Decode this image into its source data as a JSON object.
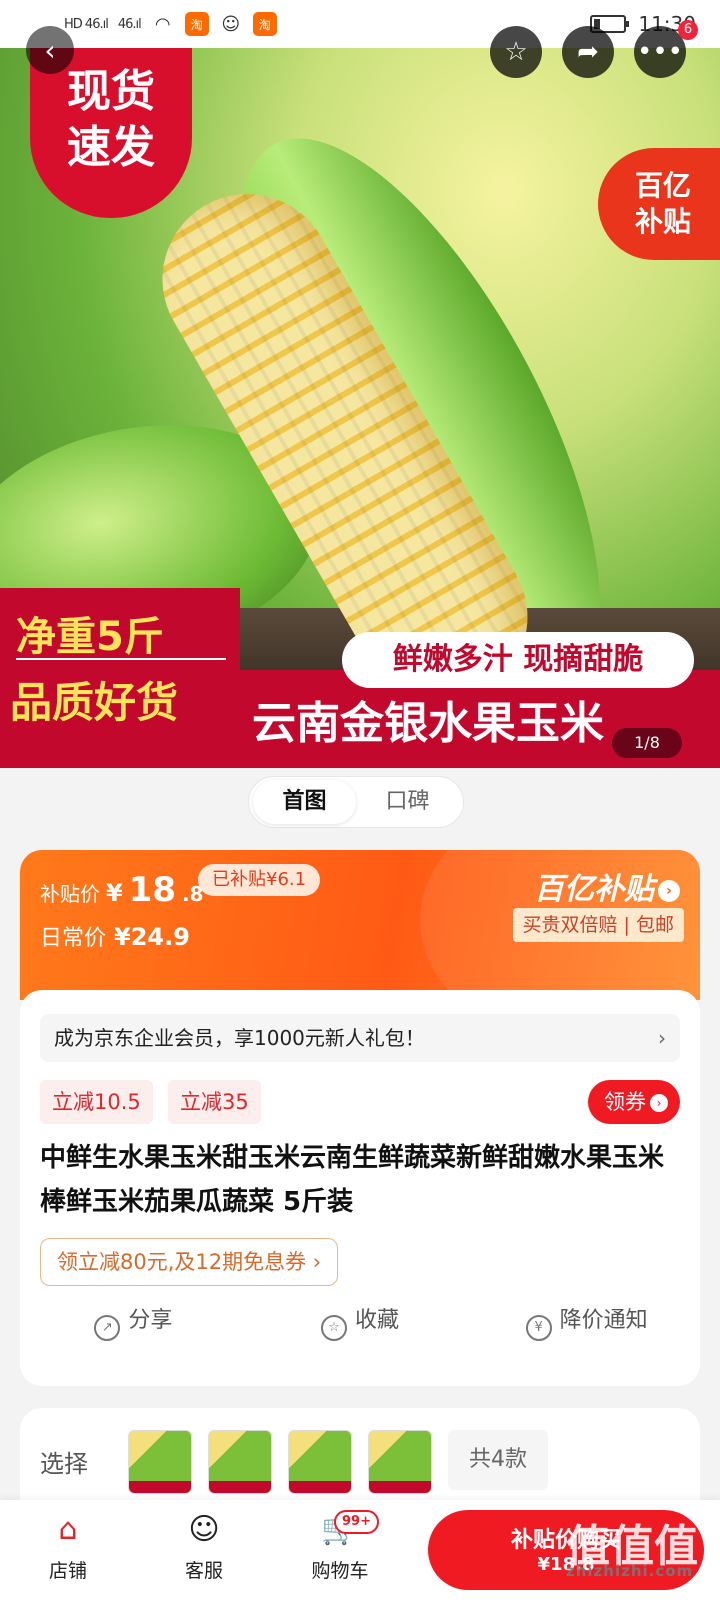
{
  "status_bar": {
    "signal1": "HD 46.ıl",
    "signal2": "46.ıl",
    "app_icon": "淘",
    "wechat_icon": "wechat-icon",
    "time": "11:30",
    "battery": "battery-icon"
  },
  "hero": {
    "badge_line1": "现货",
    "badge_line2": "速发",
    "yi_line1": "百亿",
    "yi_line2": "补贴",
    "net_weight": "净重5斤",
    "quality": "品质好货",
    "slogan": "鲜嫩多汁 现摘甜脆",
    "title": "云南金银水果玉米",
    "image_counter": "1/8",
    "more_badge": "6"
  },
  "tabs": [
    {
      "label": "首图",
      "active": true
    },
    {
      "label": "口碑",
      "active": false
    }
  ],
  "price": {
    "subsidy_label": "补贴价",
    "currency": "¥",
    "price_int": "18",
    "price_dec": ".8",
    "subsidy_tag": "已补贴¥6.1",
    "daily_label": "日常价",
    "daily_price": "¥24.9",
    "yi_logo": "百亿补贴",
    "guarantee": "买贵双倍赔 | 包邮"
  },
  "main": {
    "member_text": "成为京东企业会员，享1000元新人礼包！",
    "coupon1": "立减10.5",
    "coupon2": "立减35",
    "get_coupon": "领券",
    "title": "中鲜生水果玉米甜玉米云南生鲜蔬菜新鲜甜嫩水果玉米棒鲜玉米茄果瓜蔬菜 5斤装",
    "promo": "领立减80元,及12期免息券 ›",
    "actions": [
      {
        "label": "分享",
        "icon": "share-icon"
      },
      {
        "label": "收藏",
        "icon": "star-icon"
      },
      {
        "label": "降价通知",
        "icon": "price-alert-icon"
      }
    ]
  },
  "select": {
    "label": "选择",
    "total": "共4款"
  },
  "bottom_nav": {
    "store": "店铺",
    "service": "客服",
    "cart": "购物车",
    "cart_badge": "99+",
    "buy_line1": "补贴价购买",
    "buy_line2": "¥18.8"
  },
  "watermark": {
    "text": "值值值",
    "url": "zhizhizhi.com"
  },
  "colors": {
    "accent_red": "#f01a23",
    "orange": "#ff5a15",
    "banner_red": "#c2082c"
  }
}
